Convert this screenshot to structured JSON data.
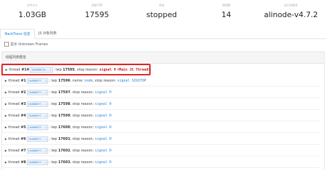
{
  "stats": [
    {
      "label": "文件大小",
      "value": "1.03GB"
    },
    {
      "label": "进程 PID",
      "value": "17595"
    },
    {
      "label": "状态",
      "value": "stopped"
    },
    {
      "label": "线程数",
      "value": "14"
    },
    {
      "label": "运行时版本",
      "value": "alinode-v4.7.2"
    }
  ],
  "tabs": [
    {
      "label": "BackTrace 信息"
    },
    {
      "label": "JS 对象列表"
    }
  ],
  "filter": {
    "label": "显示 Unknown Frames"
  },
  "panel": {
    "title": "线程列表概览"
  },
  "threads": [
    {
      "prefix": "thread",
      "num": "#14",
      "addr": "(0x00007fa...)",
      "lwp": ": lwp ",
      "pid": "17595",
      "stop": ", stop reason: ",
      "signal": "signal 0",
      "extra": "<Main JS Thread>"
    },
    {
      "prefix": "thread",
      "num": "#1",
      "addr": "(0x00007f...)",
      "lwp": ": lwp ",
      "pid": "17596",
      "name_label": ", name: ",
      "name": "node",
      "stop": ", stop reason: ",
      "signal": "signal SIGSTOP"
    },
    {
      "prefix": "thread",
      "num": "#2",
      "addr": "(0x00007f...)",
      "lwp": ": lwp ",
      "pid": "17597",
      "stop": ", stop reason: ",
      "signal": "signal 0"
    },
    {
      "prefix": "thread",
      "num": "#3",
      "addr": "(0x00007f...)",
      "lwp": ": lwp ",
      "pid": "17598",
      "stop": ", stop reason: ",
      "signal": "signal 0"
    },
    {
      "prefix": "thread",
      "num": "#4",
      "addr": "(0x00007f...)",
      "lwp": ": lwp ",
      "pid": "17599",
      "stop": ", stop reason: ",
      "signal": "signal 0"
    },
    {
      "prefix": "thread",
      "num": "#5",
      "addr": "(0x00007f...)",
      "lwp": ": lwp ",
      "pid": "17600",
      "stop": ", stop reason: ",
      "signal": "signal 0"
    },
    {
      "prefix": "thread",
      "num": "#6",
      "addr": "(0x00007f...)",
      "lwp": ": lwp ",
      "pid": "17601",
      "stop": ", stop reason: ",
      "signal": "signal 0"
    },
    {
      "prefix": "thread",
      "num": "#7",
      "addr": "(0x00007f...)",
      "lwp": ": lwp ",
      "pid": "17602",
      "stop": ", stop reason: ",
      "signal": "signal 0"
    },
    {
      "prefix": "thread",
      "num": "#8",
      "addr": "(0x00007f...)",
      "lwp": ": lwp ",
      "pid": "17603",
      "stop": ", stop reason: ",
      "signal": "signal 0"
    }
  ],
  "icons": {
    "row_toggle": "triangle-right-icon",
    "checkbox": "checkbox-icon"
  },
  "colors": {
    "highlight_border": "#e02020",
    "link": "#1a7fd6"
  }
}
